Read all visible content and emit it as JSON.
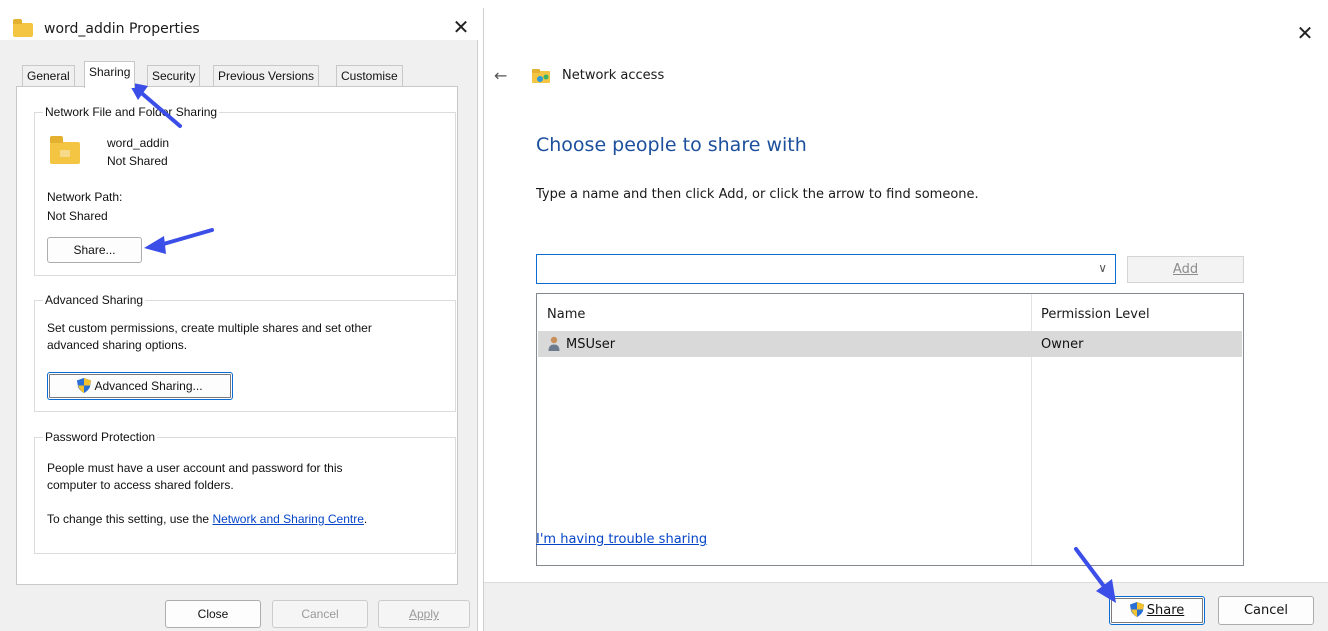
{
  "properties_dialog": {
    "title": "word_addin Properties",
    "close_glyph": "✕",
    "tabs": [
      {
        "label": "General",
        "active": false
      },
      {
        "label": "Sharing",
        "active": true
      },
      {
        "label": "Security",
        "active": false
      },
      {
        "label": "Previous Versions",
        "active": false
      },
      {
        "label": "Customise",
        "active": false
      }
    ],
    "network_sharing": {
      "group_label": "Network File and Folder Sharing",
      "folder_name": "word_addin",
      "folder_status": "Not Shared",
      "network_path_label": "Network Path:",
      "network_path_value": "Not Shared",
      "share_button": "Share..."
    },
    "advanced_sharing": {
      "group_label": "Advanced Sharing",
      "description_line1": "Set custom permissions, create multiple shares and set other",
      "description_line2": "advanced sharing options.",
      "button": "Advanced Sharing..."
    },
    "password_protection": {
      "group_label": "Password Protection",
      "line1": "People must have a user account and password for this",
      "line2": "computer to access shared folders.",
      "change_prefix": "To change this setting, use the ",
      "link": "Network and Sharing Centre",
      "change_suffix": "."
    },
    "footer": {
      "close": "Close",
      "cancel": "Cancel",
      "apply": "Apply"
    }
  },
  "network_access_wizard": {
    "close_glyph": "✕",
    "back_glyph": "←",
    "title": "Network access",
    "heading": "Choose people to share with",
    "instruction": "Type a name and then click Add, or click the arrow to find someone.",
    "name_input_value": "",
    "dropdown_glyph": "∨",
    "add_button": "Add",
    "list": {
      "columns": [
        "Name",
        "Permission Level"
      ],
      "rows": [
        {
          "name": "MSUser",
          "permission": "Owner"
        }
      ]
    },
    "trouble_link": "I'm having trouble sharing",
    "share_button": "Share",
    "cancel_button": "Cancel"
  },
  "colors": {
    "accent_arrow": "#3b4ee8",
    "heading_blue": "#1c4f9c",
    "link_blue": "#0645c8",
    "shield_blue": "#2a6fd6",
    "shield_yellow": "#f2c12e"
  }
}
